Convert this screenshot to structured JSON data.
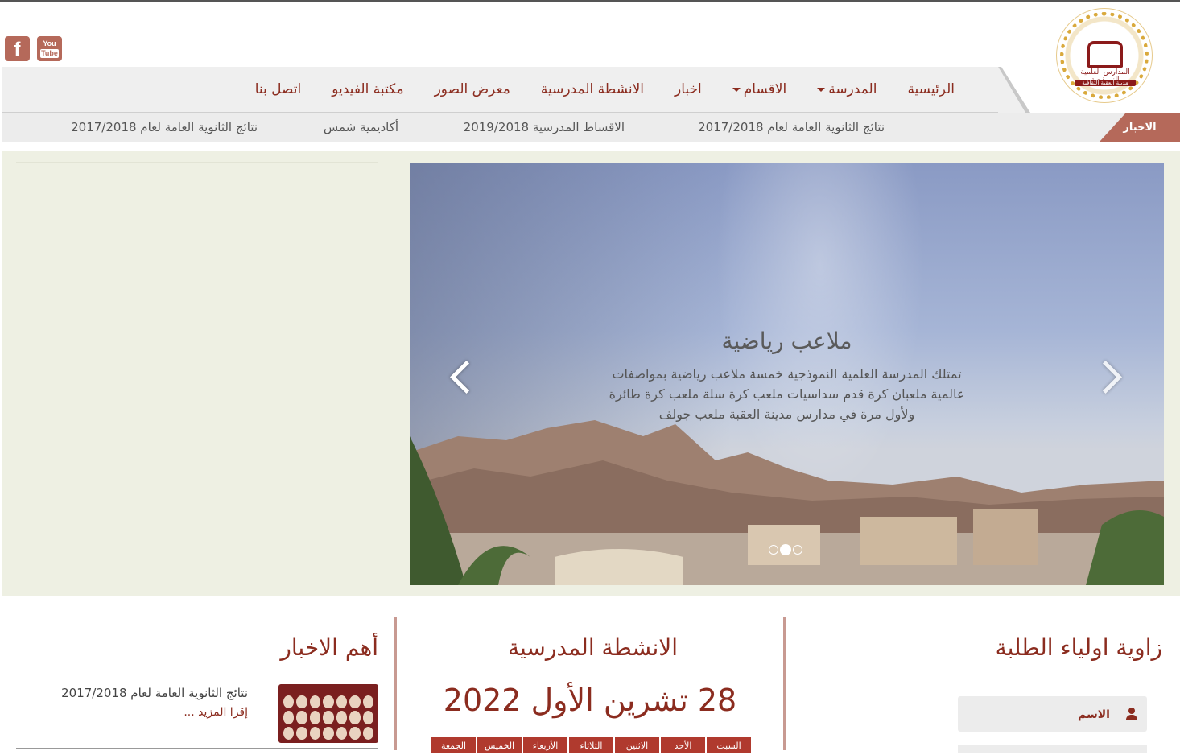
{
  "header": {
    "logo_text_top": "المدارس العلمية النموذجية",
    "logo_text_bottom": "مدينة العقبة الثقافية",
    "social": [
      {
        "icon": "facebook-icon",
        "label": "f"
      },
      {
        "icon": "youtube-icon",
        "label_top": "You",
        "label_bottom": "Tube"
      }
    ]
  },
  "nav": {
    "items": [
      {
        "label": "الرئيسية",
        "dropdown": false
      },
      {
        "label": "المدرسة",
        "dropdown": true
      },
      {
        "label": "الاقسام",
        "dropdown": true
      },
      {
        "label": "اخبار",
        "dropdown": false
      },
      {
        "label": "الانشطة المدرسية",
        "dropdown": false
      },
      {
        "label": "معرض الصور",
        "dropdown": false
      },
      {
        "label": "مكتبة الفيديو",
        "dropdown": false
      },
      {
        "label": "اتصل بنا",
        "dropdown": false
      }
    ]
  },
  "ticker": {
    "label": "الاخبار",
    "items": [
      "نتائج الثانوية العامة لعام 2017/2018",
      "الاقساط المدرسية 2019/2018",
      "أكاديمية شمس",
      "نتائج الثانوية العامة لعام 2017/2018"
    ]
  },
  "slider": {
    "title": "ملاعب رياضية",
    "body": "تمتلك المدرسة العلمية النموذجية خمسة ملاعب رياضية بمواصفات عالمية ملعبان كرة قدم سداسيات ملعب كرة سلة ملعب كرة طائرة ولأول مرة في مدارس مدينة العقبة ملعب جولف",
    "slide_count": 3,
    "active_slide": 2,
    "colors": {
      "sky": "#a6b5d6",
      "mountain": "#9a7a6a"
    }
  },
  "sections": {
    "news": {
      "title": "أهم الاخبار",
      "item_title": "نتائج الثانوية العامة لعام 2017/2018",
      "more": "إقرا المزيد ..."
    },
    "activities": {
      "title": "الانشطة المدرسية",
      "date": "28 تشرين الأول 2022",
      "weekdays": [
        "السبت",
        "الأحد",
        "الاثنين",
        "الثلاثاء",
        "الأربعاء",
        "الخميس",
        "الجمعة"
      ]
    },
    "parents": {
      "title": "زاوية اولياء الطلبة",
      "name_label": "الاسم"
    }
  },
  "colors": {
    "accent": "#8b2c1f",
    "ticker_label_bg": "#b5695a",
    "hero_bg": "#eef0e3"
  }
}
